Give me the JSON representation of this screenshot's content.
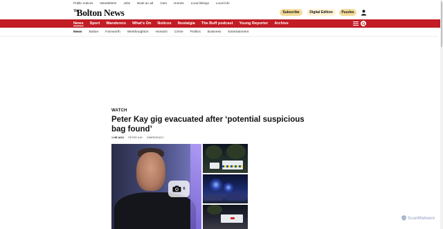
{
  "utility_bar": [
    "Public notices",
    "Newsletters",
    "Jobs",
    "Book an ad",
    "Cars",
    "Homes",
    "Local listings",
    "Local info"
  ],
  "masthead": {
    "logo_prefix": "The",
    "logo": "Bolton News",
    "subscribe": "Subscribe",
    "digital_edition": "Digital Edition",
    "puzzles": "Puzzles",
    "user_icon": "user-icon"
  },
  "nav": {
    "items": [
      "News",
      "Sport",
      "Wanderers",
      "What's On",
      "Notices",
      "Nostalgia",
      "The Buff podcast",
      "Young Reporter",
      "Archive"
    ],
    "active": "News",
    "menu_icon": "hamburger-menu-icon",
    "search_icon": "search-icon"
  },
  "sub_nav": {
    "items": [
      "News",
      "Bolton",
      "Farnworth",
      "Westhoughton",
      "Horwich",
      "Crime",
      "Politics",
      "Business",
      "Entertainment"
    ],
    "active": "News"
  },
  "article": {
    "kicker": "WATCH",
    "headline": "Peter Kay gig evacuated after ‘potential suspicious bag found’",
    "time": "1 HR AGO",
    "author": "PETER KAY",
    "tag": "EMERGENCY",
    "photo_count": "6",
    "photo_icon": "camera-icon"
  },
  "watermark": {
    "text": "ScanMalware",
    "icon": "shield-icon"
  },
  "colors": {
    "nav_red": "#c21c24",
    "subscribe_gold": "#f4dc9a",
    "digital_cream": "#fff3d6"
  }
}
